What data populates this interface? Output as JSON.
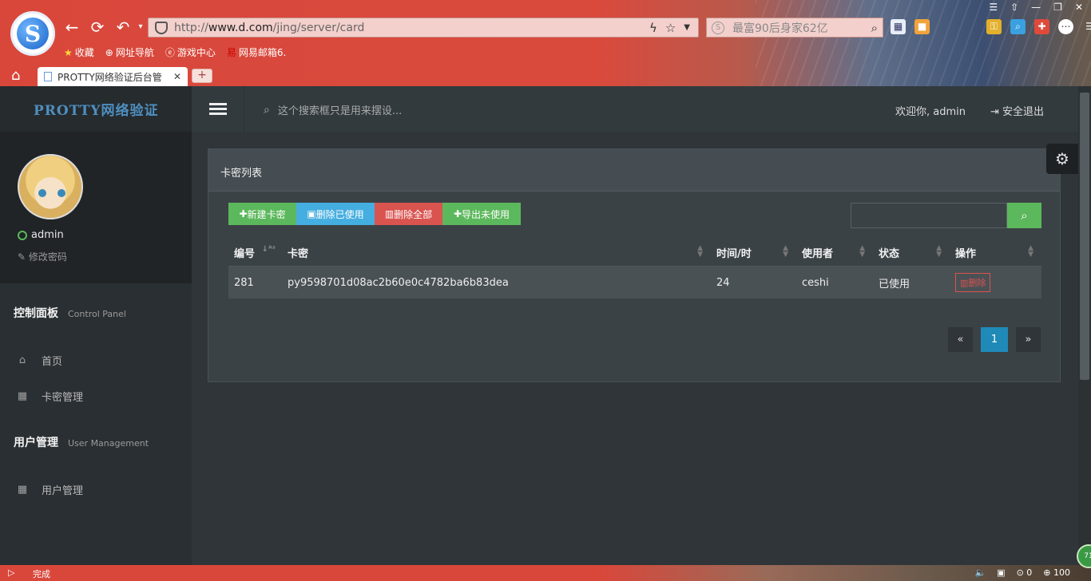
{
  "browser": {
    "url_prefix": "http://",
    "url_host": "www.d.com",
    "url_path": "/jing/server/card",
    "search_placeholder": "最富90后身家62亿",
    "bookmarks": [
      "收藏",
      "网址导航",
      "游戏中心",
      "网易邮箱6."
    ],
    "tab_title": "PROTTY网络验证后台管",
    "status_text": "完成",
    "zoom": "100",
    "download_count": "0",
    "badge": "71"
  },
  "sidebar": {
    "brand": "PROTTY网络验证",
    "user_name": "admin",
    "change_password": "修改密码",
    "sections": [
      {
        "title": "控制面板",
        "subtitle": "Control Panel"
      },
      {
        "title": "用户管理",
        "subtitle": "User Management"
      }
    ],
    "items": [
      {
        "label": "首页",
        "icon": "home-icon"
      },
      {
        "label": "卡密管理",
        "icon": "table-icon"
      },
      {
        "label": "用户管理",
        "icon": "table-icon"
      }
    ]
  },
  "topbar": {
    "search_placeholder": "这个搜索框只是用来摆设...",
    "welcome": "欢迎你, admin",
    "logout": "安全退出"
  },
  "panel": {
    "title": "卡密列表",
    "buttons": {
      "new": "新建卡密",
      "delete_used": "删除已使用",
      "delete_all": "删除全部",
      "export_unused": "导出未使用"
    },
    "columns": [
      "编号",
      "卡密",
      "时间/时",
      "使用者",
      "状态",
      "操作"
    ],
    "rows": [
      {
        "id": "281",
        "card": "py9598701d08ac2b60e0c4782ba6b83dea",
        "hours": "24",
        "user": "ceshi",
        "status": "已使用",
        "action": "删除"
      }
    ],
    "pagination": {
      "prev": "«",
      "current": "1",
      "next": "»"
    }
  },
  "colors": {
    "accent_green": "#5cb85c",
    "accent_blue": "#45aee0",
    "accent_red": "#d9534f",
    "page_active": "#1f8ab8"
  }
}
